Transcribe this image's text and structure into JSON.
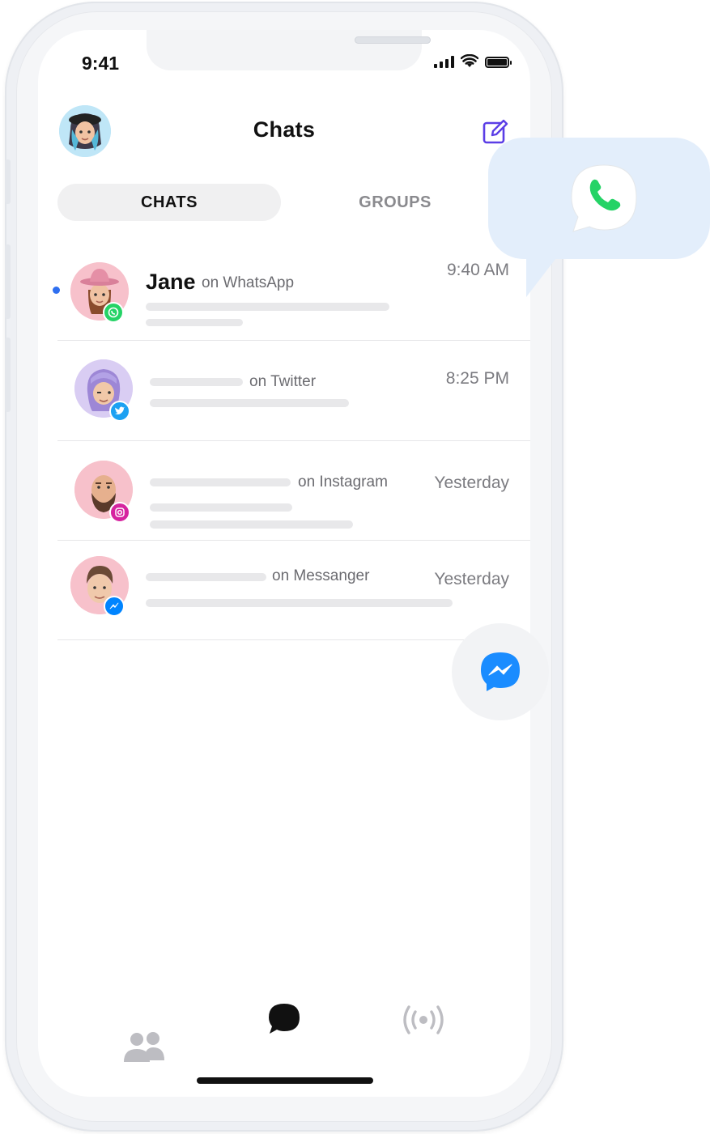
{
  "status_bar": {
    "time": "9:41"
  },
  "header": {
    "title": "Chats"
  },
  "tabs": [
    {
      "label": "CHATS",
      "active": true
    },
    {
      "label": "GROUPS",
      "active": false
    }
  ],
  "chats": [
    {
      "name": "Jane",
      "network": "on WhatsApp",
      "time": "9:40 AM",
      "unread": true,
      "badge_icon": "whatsapp-icon",
      "badge_color": "#25D366",
      "avatar_bg": "#f7c1cb"
    },
    {
      "name": "",
      "network": "on Twitter",
      "time": "8:25 PM",
      "unread": false,
      "badge_icon": "twitter-icon",
      "badge_color": "#1DA1F2",
      "avatar_bg": "#d9cdf3"
    },
    {
      "name": "",
      "network": "on Instagram",
      "time": "Yesterday",
      "unread": false,
      "badge_icon": "instagram-icon",
      "badge_color": "#d6249f",
      "avatar_bg": "#f7c1cb"
    },
    {
      "name": "",
      "network": "on Messanger",
      "time": "Yesterday",
      "unread": false,
      "badge_icon": "messenger-icon",
      "badge_color": "#0084ff",
      "avatar_bg": "#f7c1cb"
    }
  ],
  "fab": {
    "icon": "messenger-icon",
    "color": "#1a8cff"
  },
  "tab_bar": [
    {
      "icon": "contacts-icon",
      "active": false
    },
    {
      "icon": "chat-bubble-icon",
      "active": true
    },
    {
      "icon": "broadcast-icon",
      "active": false
    }
  ],
  "floating_bubble": {
    "icon": "whatsapp-phone-icon",
    "color": "#25D366"
  },
  "colors": {
    "accent": "#5b3ee6",
    "unread_dot": "#2f6ff0",
    "bubble_bg": "#e3eefb"
  }
}
